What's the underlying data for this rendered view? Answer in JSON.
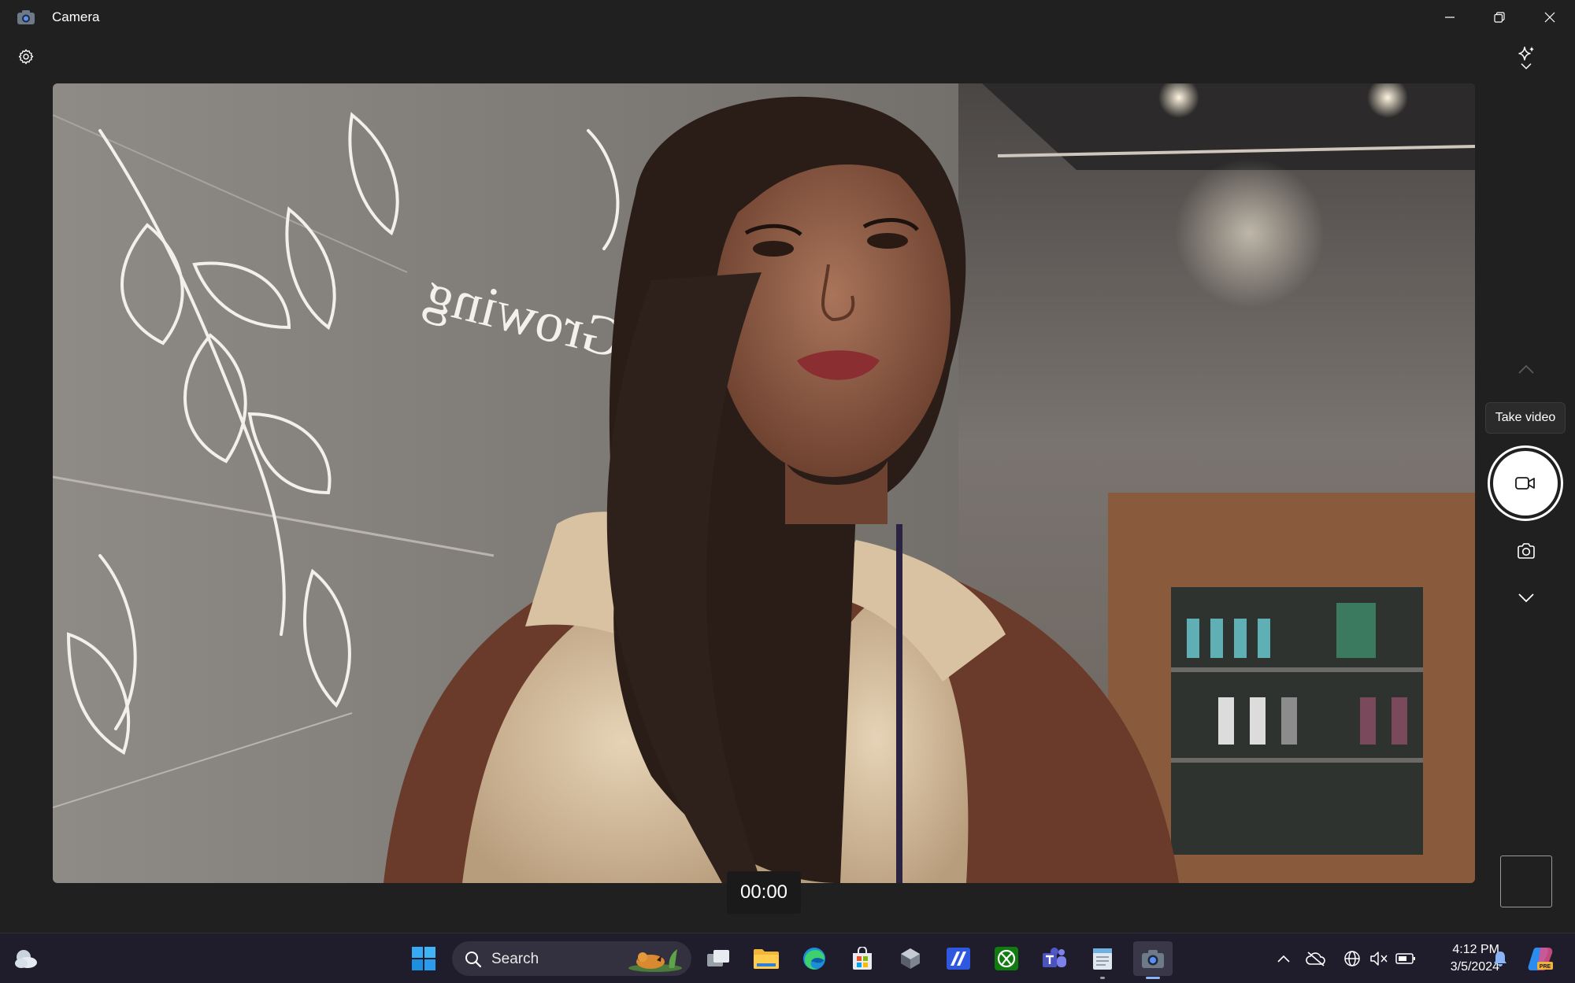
{
  "window": {
    "title": "Camera",
    "controls": {
      "minimize": "minimize-icon",
      "maximize": "restore-icon",
      "close": "close-icon"
    }
  },
  "toolbar": {
    "settings_icon": "gear-icon",
    "effects_icon": "sparkle-icon"
  },
  "capture": {
    "tooltip": "Take video",
    "video_icon": "video-camera-icon",
    "photo_icon": "camera-icon",
    "mode_up_icon": "chevron-up-icon",
    "mode_down_icon": "chevron-down-icon",
    "timer": "00:00"
  },
  "viewfinder": {
    "wall_text": "Growing"
  },
  "taskbar": {
    "search_placeholder": "Search",
    "apps": [
      "start-icon",
      "search-icon",
      "task-view-icon",
      "file-explorer-icon",
      "edge-icon",
      "store-icon",
      "app-icon",
      "app-icon",
      "xbox-icon",
      "teams-icon",
      "notepad-icon",
      "camera-icon"
    ],
    "clock": {
      "time": "4:12 PM",
      "date": "3/5/2024"
    }
  },
  "colors": {
    "background": "#202020",
    "taskbar": "#1f1d2b",
    "accent": "#0078d4"
  }
}
